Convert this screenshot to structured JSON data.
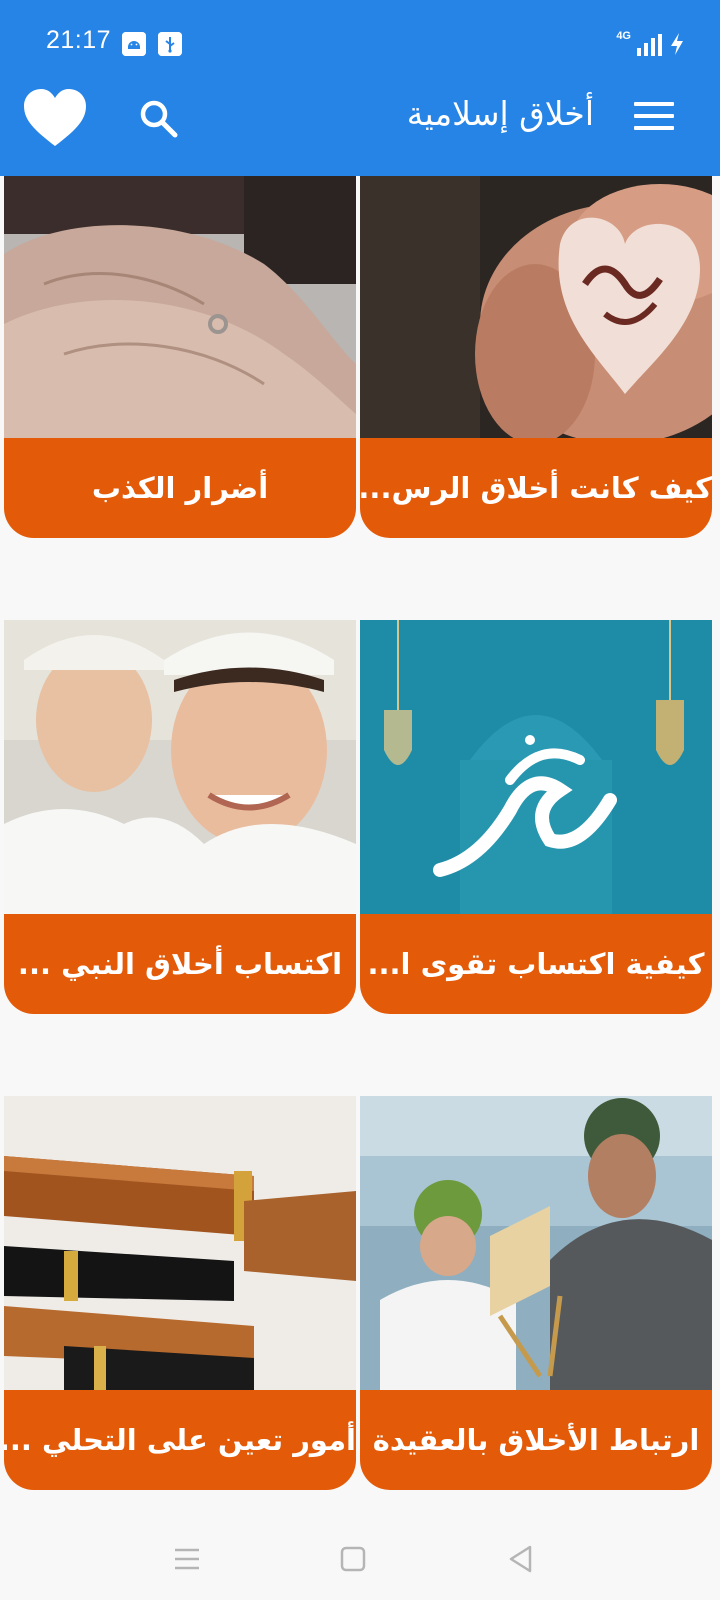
{
  "status_bar": {
    "time": "21:17",
    "network": "4G",
    "icons": [
      "android-debug-icon",
      "usb-icon",
      "signal-icon",
      "charging-icon"
    ]
  },
  "app_bar": {
    "title": "أخلاق إسلامية",
    "icons": [
      "menu-icon",
      "search-icon",
      "favorite-heart-icon"
    ]
  },
  "cards": [
    {
      "label": "كيف كانت أخلاق الرس...",
      "image": "hands-holding-muhammad-calligraphy"
    },
    {
      "label": "أضرار الكذب",
      "image": "elderly-hands"
    },
    {
      "label": "كيفية اكتساب تقوى ا...",
      "image": "muhammad-calligraphy-blue-lanterns"
    },
    {
      "label": "اكتساب أخلاق النبي ...",
      "image": "young-men-with-kufi-caps"
    },
    {
      "label": "ارتباط الأخلاق بالعقيدة",
      "image": "man-and-boy-reading-quran"
    },
    {
      "label": "أمور تعين على التحلي ...",
      "image": "fountain-pens"
    }
  ],
  "nav_bar": {
    "icons": [
      "recent-apps-icon",
      "home-icon",
      "back-icon"
    ]
  },
  "colors": {
    "primary": "#2684e6",
    "card_label": "#e35a08",
    "background": "#f8f8f8"
  }
}
